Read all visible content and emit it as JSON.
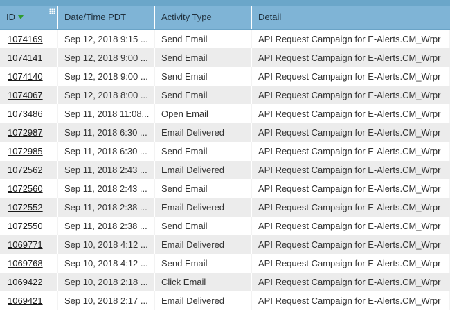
{
  "table": {
    "headers": [
      "ID",
      "Date/Time PDT",
      "Activity Type",
      "Detail"
    ],
    "sort_indicator": "sort-descending-icon",
    "rows": [
      {
        "id": "1074169",
        "datetime": "Sep 12, 2018 9:15 ...",
        "type": "Send Email",
        "detail": "API Request Campaign for E-Alerts.CM_Wrpr"
      },
      {
        "id": "1074141",
        "datetime": "Sep 12, 2018 9:00 ...",
        "type": "Send Email",
        "detail": "API Request Campaign for E-Alerts.CM_Wrpr"
      },
      {
        "id": "1074140",
        "datetime": "Sep 12, 2018 9:00 ...",
        "type": "Send Email",
        "detail": "API Request Campaign for E-Alerts.CM_Wrpr"
      },
      {
        "id": "1074067",
        "datetime": "Sep 12, 2018 8:00 ...",
        "type": "Send Email",
        "detail": "API Request Campaign for E-Alerts.CM_Wrpr"
      },
      {
        "id": "1073486",
        "datetime": "Sep 11, 2018 11:08...",
        "type": "Open Email",
        "detail": "API Request Campaign for E-Alerts.CM_Wrpr"
      },
      {
        "id": "1072987",
        "datetime": "Sep 11, 2018 6:30 ...",
        "type": "Email Delivered",
        "detail": "API Request Campaign for E-Alerts.CM_Wrpr"
      },
      {
        "id": "1072985",
        "datetime": "Sep 11, 2018 6:30 ...",
        "type": "Send Email",
        "detail": "API Request Campaign for E-Alerts.CM_Wrpr"
      },
      {
        "id": "1072562",
        "datetime": "Sep 11, 2018 2:43 ...",
        "type": "Email Delivered",
        "detail": "API Request Campaign for E-Alerts.CM_Wrpr"
      },
      {
        "id": "1072560",
        "datetime": "Sep 11, 2018 2:43 ...",
        "type": "Send Email",
        "detail": "API Request Campaign for E-Alerts.CM_Wrpr"
      },
      {
        "id": "1072552",
        "datetime": "Sep 11, 2018 2:38 ...",
        "type": "Email Delivered",
        "detail": "API Request Campaign for E-Alerts.CM_Wrpr"
      },
      {
        "id": "1072550",
        "datetime": "Sep 11, 2018 2:38 ...",
        "type": "Send Email",
        "detail": "API Request Campaign for E-Alerts.CM_Wrpr"
      },
      {
        "id": "1069771",
        "datetime": "Sep 10, 2018 4:12 ...",
        "type": "Email Delivered",
        "detail": "API Request Campaign for E-Alerts.CM_Wrpr"
      },
      {
        "id": "1069768",
        "datetime": "Sep 10, 2018 4:12 ...",
        "type": "Send Email",
        "detail": "API Request Campaign for E-Alerts.CM_Wrpr"
      },
      {
        "id": "1069422",
        "datetime": "Sep 10, 2018 2:18 ...",
        "type": "Click Email",
        "detail": "API Request Campaign for E-Alerts.CM_Wrpr"
      },
      {
        "id": "1069421",
        "datetime": "Sep 10, 2018 2:17 ...",
        "type": "Email Delivered",
        "detail": "API Request Campaign for E-Alerts.CM_Wrpr"
      }
    ]
  }
}
